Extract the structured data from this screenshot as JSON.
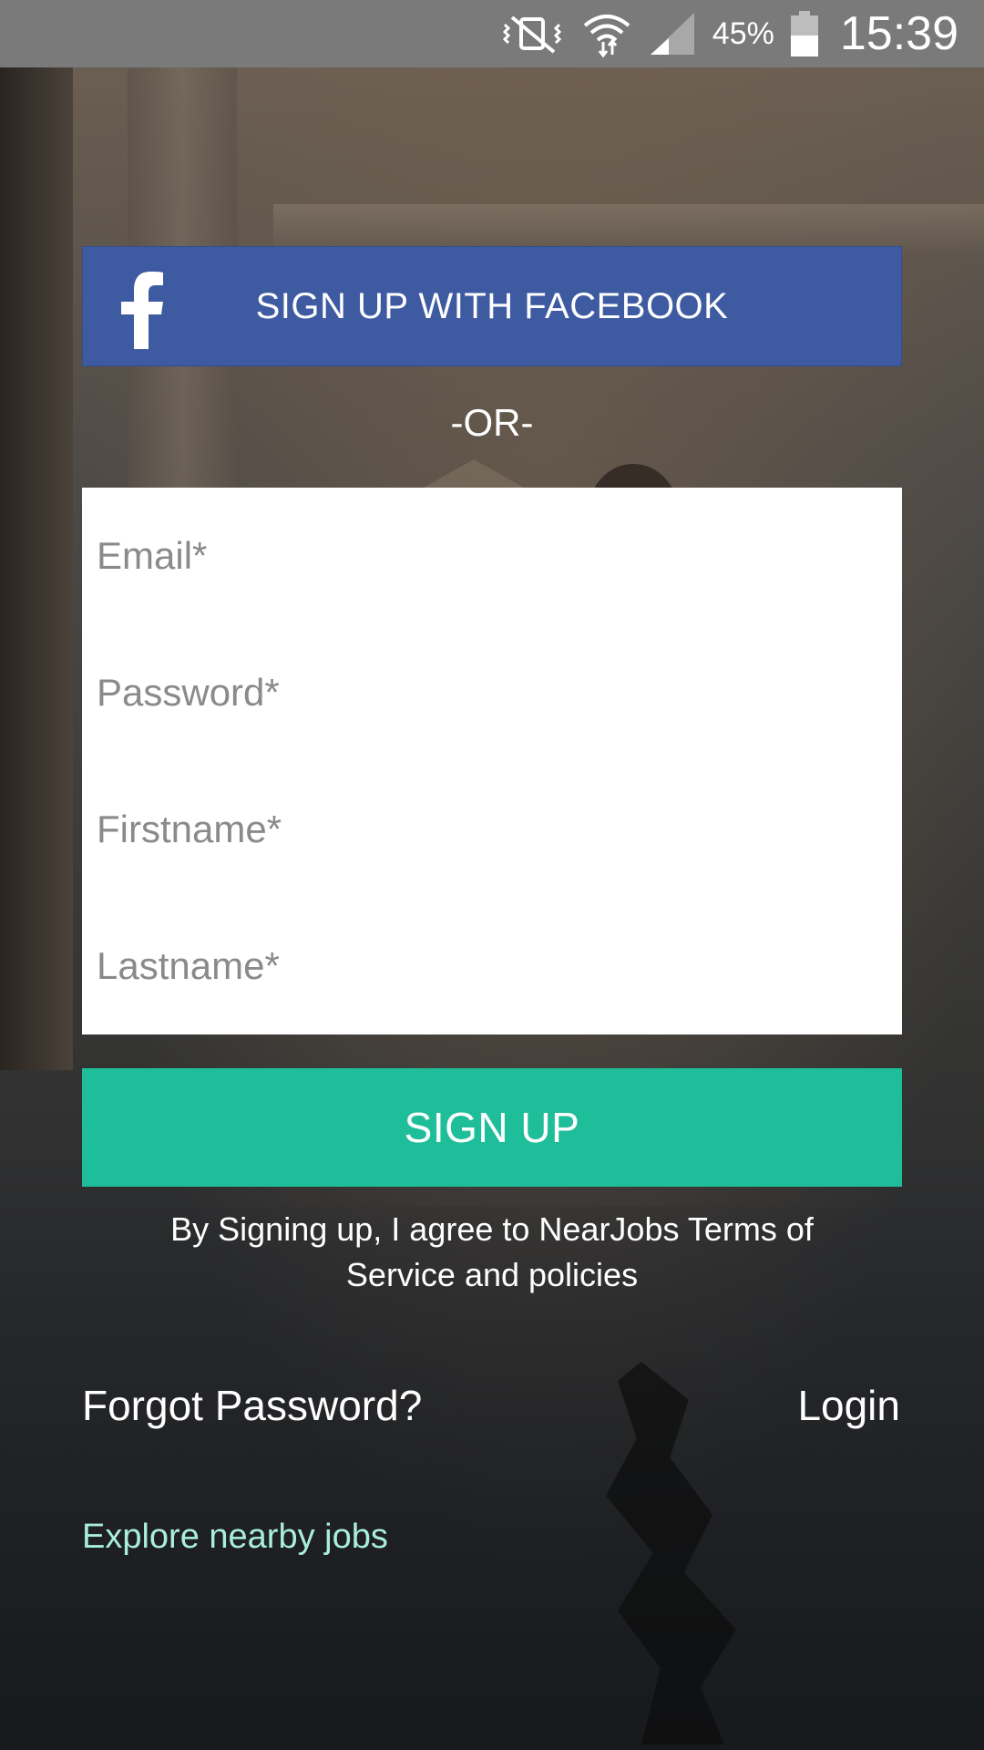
{
  "status_bar": {
    "battery_percent": "45%",
    "time": "15:39",
    "icons": [
      "vibrate-mute-icon",
      "wifi-icon",
      "cell-signal-icon",
      "battery-icon"
    ]
  },
  "facebook_button": {
    "label": "SIGN UP WITH FACEBOOK",
    "icon": "facebook-icon",
    "color": "#3e5aa1"
  },
  "divider": {
    "text": "-OR-"
  },
  "form": {
    "email_placeholder": "Email*",
    "email_value": "",
    "password_placeholder": "Password*",
    "password_value": "",
    "firstname_placeholder": "Firstname*",
    "firstname_value": "",
    "lastname_placeholder": "Lastname*",
    "lastname_value": ""
  },
  "signup_button": {
    "label": "SIGN UP",
    "color": "#1fbe9a"
  },
  "terms": {
    "line1": "By Signing up, I agree to NearJobs Terms of",
    "line2": "Service and policies"
  },
  "links": {
    "forgot_password": "Forgot Password?",
    "login": "Login",
    "explore": "Explore nearby jobs",
    "explore_color": "#a9eedd"
  }
}
